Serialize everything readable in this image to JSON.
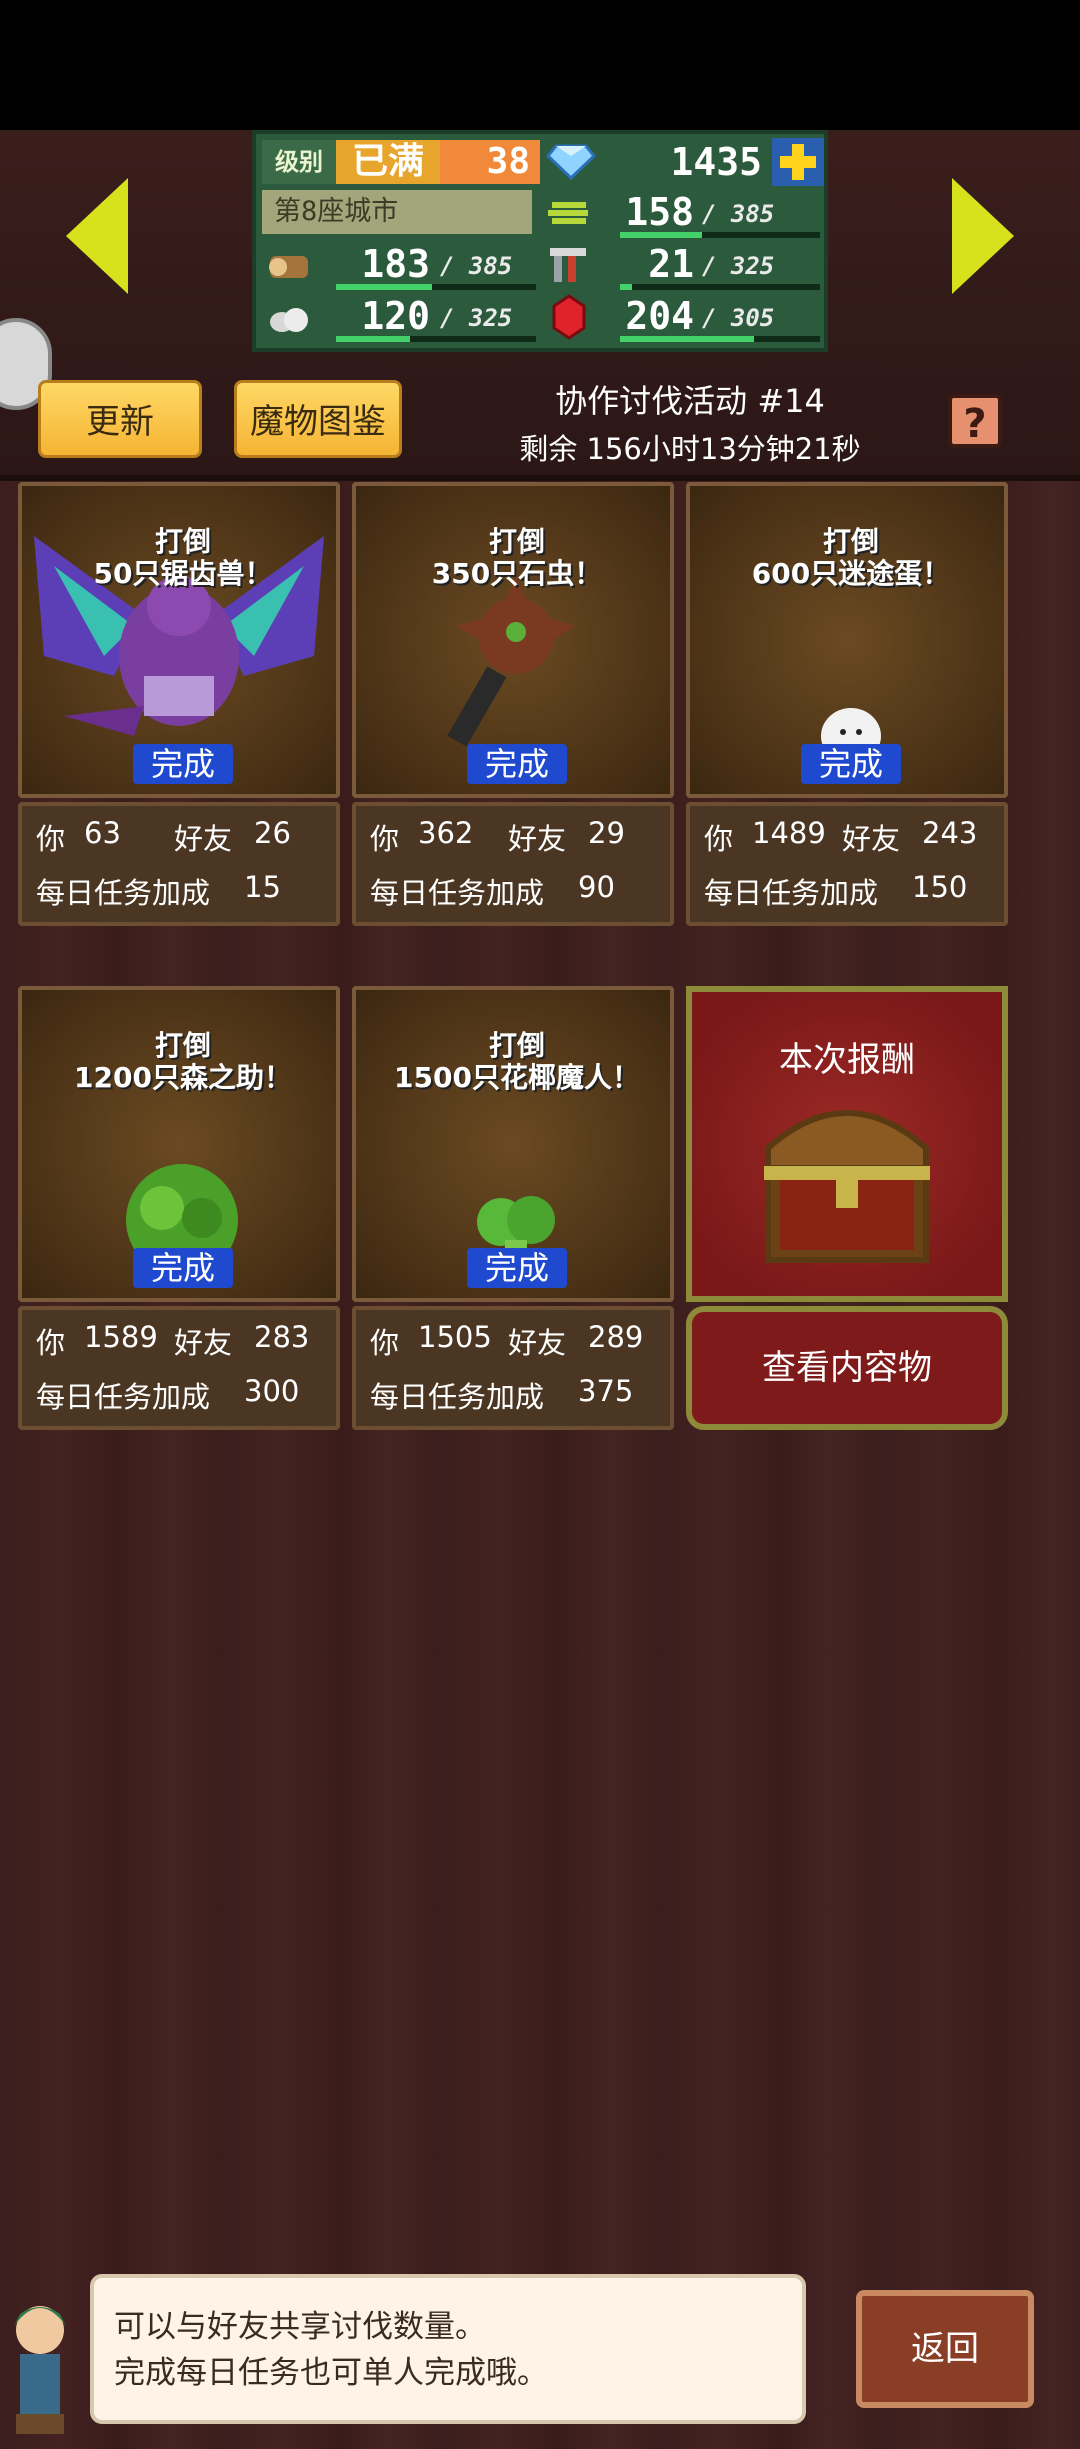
{
  "stats": {
    "level_label": "级别",
    "level_status": "已满",
    "level": "38",
    "gems": "1435",
    "city": "第8座城市",
    "resources": [
      {
        "name": "grain",
        "value": "158",
        "max": "/ 385",
        "fill": 0.41
      },
      {
        "name": "wood",
        "value": "183",
        "max": "/ 385",
        "fill": 0.48
      },
      {
        "name": "hammers",
        "value": "21",
        "max": "/ 325",
        "fill": 0.06
      },
      {
        "name": "stone",
        "value": "120",
        "max": "/ 325",
        "fill": 0.37
      },
      {
        "name": "ruby",
        "value": "204",
        "max": "/ 305",
        "fill": 0.67
      }
    ]
  },
  "buttons": {
    "refresh": "更新",
    "monster_book": "魔物图鉴",
    "help": "?",
    "back": "返回"
  },
  "event": {
    "title": "协作讨伐活动 #14",
    "remaining": "剩余 156小时13分钟21秒"
  },
  "cards": [
    {
      "title": "打倒\n50只锯齿兽！",
      "done": "完成",
      "you_label": "你",
      "you": "63",
      "friend_label": "好友",
      "friend": "26",
      "bonus_label": "每日任务加成",
      "bonus": "15",
      "monster_icon": "purple-dragon"
    },
    {
      "title": "打倒\n350只石虫！",
      "done": "完成",
      "you_label": "你",
      "you": "362",
      "friend_label": "好友",
      "friend": "29",
      "bonus_label": "每日任务加成",
      "bonus": "90",
      "monster_icon": "stone-worm"
    },
    {
      "title": "打倒\n600只迷途蛋！",
      "done": "完成",
      "you_label": "你",
      "you": "1489",
      "friend_label": "好友",
      "friend": "243",
      "bonus_label": "每日任务加成",
      "bonus": "150",
      "monster_icon": "egg"
    },
    {
      "title": "打倒\n1200只森之助！",
      "done": "完成",
      "you_label": "你",
      "you": "1589",
      "friend_label": "好友",
      "friend": "283",
      "bonus_label": "每日任务加成",
      "bonus": "300",
      "monster_icon": "green-bush"
    },
    {
      "title": "打倒\n1500只花椰魔人！",
      "done": "完成",
      "you_label": "你",
      "you": "1505",
      "friend_label": "好友",
      "friend": "289",
      "bonus_label": "每日任务加成",
      "bonus": "375",
      "monster_icon": "broccoli"
    }
  ],
  "reward": {
    "title": "本次报酬",
    "button": "查看内容物",
    "icon": "treasure-chest"
  },
  "hint": {
    "line1": "可以与好友共享讨伐数量。",
    "line2": "完成每日任务也可单人完成哦。"
  },
  "colors": {
    "accent_gold": "#f5b433",
    "done_blue": "#1f4ad0",
    "reward_red": "#7e1a1a"
  }
}
